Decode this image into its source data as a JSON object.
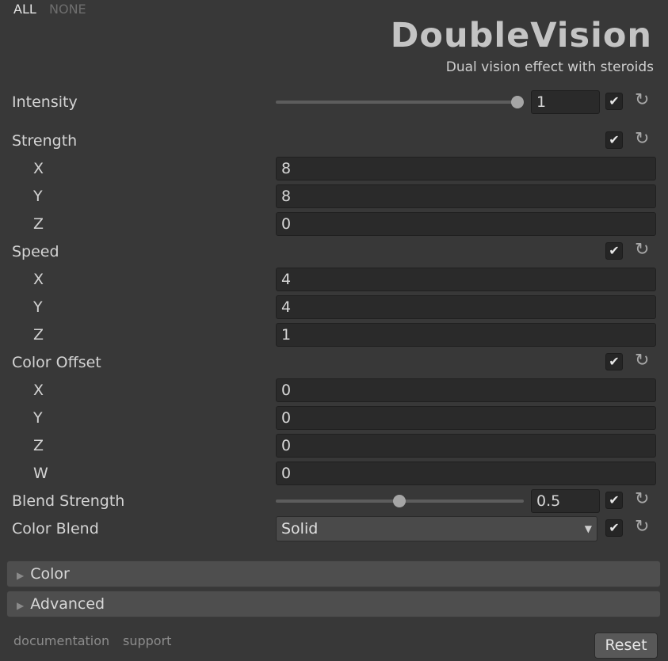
{
  "header": {
    "all_label": "ALL",
    "none_label": "NONE",
    "logo_text": "DoubleVision",
    "subtitle": "Dual vision effect with steroids"
  },
  "intensity": {
    "label": "Intensity",
    "value": "1",
    "fraction": 1.0
  },
  "strength": {
    "label": "Strength",
    "x_label": "X",
    "x": "8",
    "y_label": "Y",
    "y": "8",
    "z_label": "Z",
    "z": "0"
  },
  "speed": {
    "label": "Speed",
    "x_label": "X",
    "x": "4",
    "y_label": "Y",
    "y": "4",
    "z_label": "Z",
    "z": "1"
  },
  "color_offset": {
    "label": "Color Offset",
    "x_label": "X",
    "x": "0",
    "y_label": "Y",
    "y": "0",
    "z_label": "Z",
    "z": "0",
    "w_label": "W",
    "w": "0"
  },
  "blend_strength": {
    "label": "Blend Strength",
    "value": "0.5",
    "fraction": 0.5
  },
  "color_blend": {
    "label": "Color Blend",
    "selected": "Solid"
  },
  "sections": {
    "color": "Color",
    "advanced": "Advanced"
  },
  "footer": {
    "documentation": "documentation",
    "support": "support",
    "reset": "Reset"
  },
  "icons": {
    "check": "checkmark-icon",
    "reset": "reset-arrow-icon",
    "triangle": "triangle-right-icon",
    "dropdown": "dropdown-arrow-icon"
  }
}
